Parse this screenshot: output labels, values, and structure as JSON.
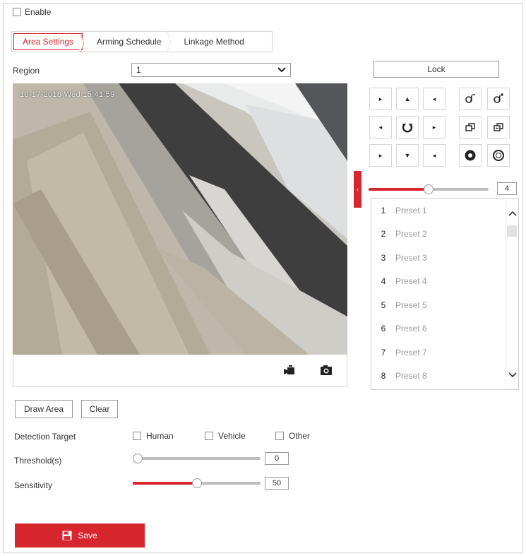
{
  "enable": {
    "label": "Enable",
    "checked": false
  },
  "tabs": [
    {
      "label": "Area Settings",
      "active": true
    },
    {
      "label": "Arming Schedule",
      "active": false
    },
    {
      "label": "Linkage Method",
      "active": false
    }
  ],
  "region": {
    "label": "Region",
    "value": "1"
  },
  "video": {
    "osd_text": "10-17-2018 Wed 15:41:59",
    "icons": [
      "record-icon",
      "snapshot-icon"
    ]
  },
  "lock_label": "Lock",
  "ptz_speed": {
    "value": "4",
    "level": 0.5
  },
  "presets": [
    {
      "num": "1",
      "name": "Preset 1"
    },
    {
      "num": "2",
      "name": "Preset 2"
    },
    {
      "num": "3",
      "name": "Preset 3"
    },
    {
      "num": "4",
      "name": "Preset 4"
    },
    {
      "num": "5",
      "name": "Preset 5"
    },
    {
      "num": "6",
      "name": "Preset 6"
    },
    {
      "num": "7",
      "name": "Preset 7"
    },
    {
      "num": "8",
      "name": "Preset 8"
    }
  ],
  "buttons": {
    "draw_area": "Draw Area",
    "clear": "Clear"
  },
  "detection": {
    "label": "Detection Target",
    "options": [
      {
        "label": "Human",
        "checked": false
      },
      {
        "label": "Vehicle",
        "checked": false
      },
      {
        "label": "Other",
        "checked": false
      }
    ]
  },
  "threshold": {
    "label": "Threshold(s)",
    "value": "0",
    "level": 0.0
  },
  "sensitivity": {
    "label": "Sensitivity",
    "value": "50",
    "level": 0.5
  },
  "save_label": "Save",
  "colors": {
    "accent": "#d7262e",
    "border": "#cfcfcf",
    "muted": "#9a9a9a"
  }
}
